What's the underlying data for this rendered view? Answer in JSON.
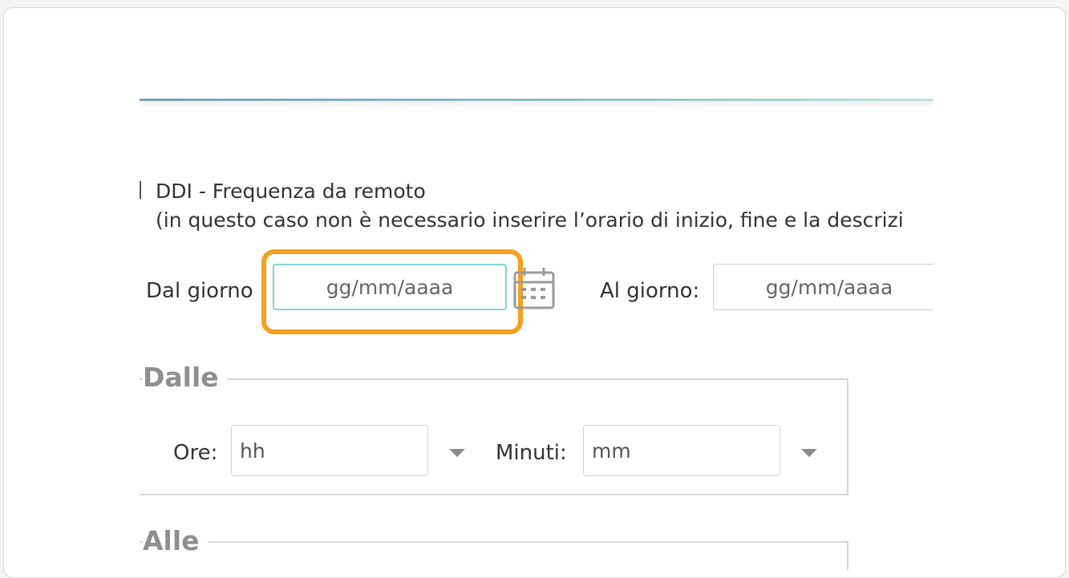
{
  "form": {
    "option_title": "DDI - Frequenza da remoto",
    "option_note": "(in questo caso non è necessario inserire l’orario di inizio, fine e la descrizi",
    "from_day_label": "Dal giorno",
    "from_day_placeholder": "gg/mm/aaaa",
    "to_day_label": "Al giorno:",
    "to_day_placeholder": "gg/mm/aaaa"
  },
  "from_time": {
    "legend": "Dalle",
    "hours_label": "Ore:",
    "hours_value": "hh",
    "minutes_label": "Minuti:",
    "minutes_value": "mm"
  },
  "to_time": {
    "legend": "Alle"
  },
  "colors": {
    "highlight": "#f5a020",
    "focus_border": "#7fd3d6",
    "legend_text": "#8f8f8f"
  },
  "icons": {
    "calendar": "calendar-icon",
    "dropdown": "caret-down-icon"
  }
}
